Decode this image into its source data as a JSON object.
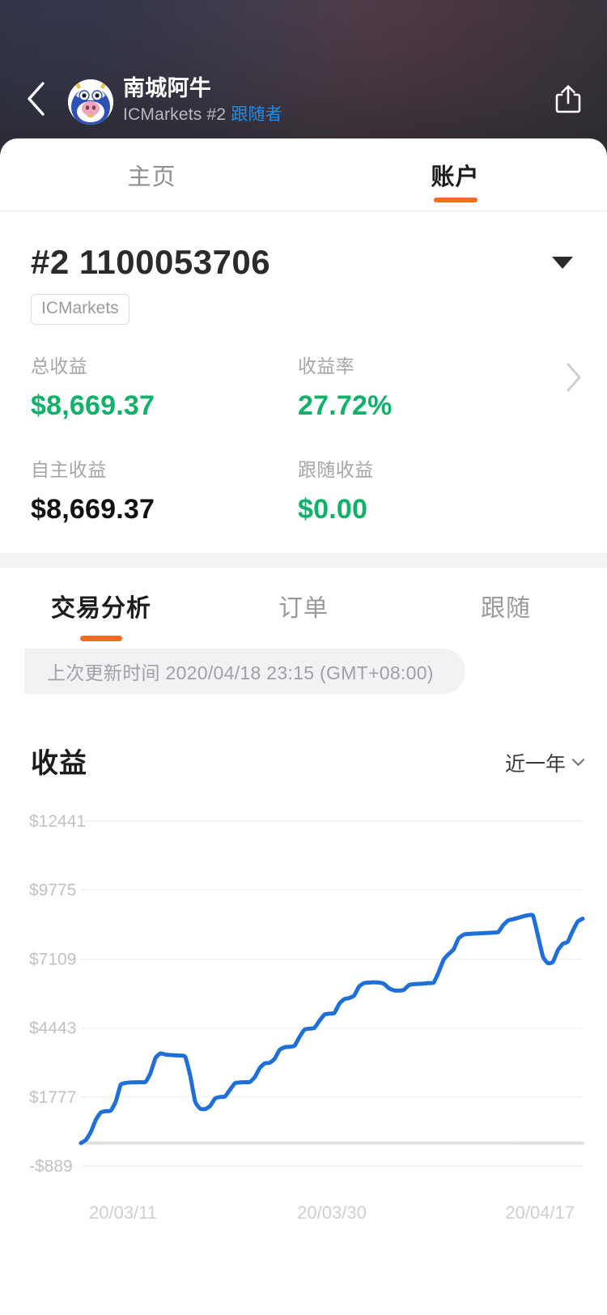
{
  "header": {
    "back_icon": "chevron-left-icon",
    "share_icon": "share-icon",
    "avatar_icon": "cow-avatar",
    "name": "南城阿牛",
    "broker": "ICMarkets",
    "account_tag": "#2",
    "follower_label": "跟随者",
    "subtitle_plain": "ICMarkets #2 "
  },
  "top_tabs": [
    {
      "label": "主页",
      "active": false
    },
    {
      "label": "账户",
      "active": true
    }
  ],
  "account": {
    "number": "#2 1100053706",
    "broker_chip": "ICMarkets",
    "dropdown_icon": "caret-down-icon",
    "detail_chevron_icon": "chevron-right-icon"
  },
  "stats": [
    {
      "label": "总收益",
      "value": "$8,669.37",
      "color": "green"
    },
    {
      "label": "收益率",
      "value": "27.72%",
      "color": "green"
    },
    {
      "label": "自主收益",
      "value": "$8,669.37",
      "color": "dark"
    },
    {
      "label": "跟随收益",
      "value": "$0.00",
      "color": "green"
    }
  ],
  "sub_tabs": [
    {
      "label": "交易分析",
      "active": true
    },
    {
      "label": "订单",
      "active": false
    },
    {
      "label": "跟随",
      "active": false
    }
  ],
  "update_banner": "上次更新时间 2020/04/18 23:15 (GMT+08:00)",
  "chart_header": {
    "title": "收益",
    "range_label": "近一年",
    "range_chevron_icon": "chevron-down-icon"
  },
  "colors": {
    "accent_orange": "#f26c21",
    "profit_green": "#0fb268",
    "line_blue": "#1e6fd9",
    "link_blue": "#1d8ced",
    "text_dark": "#1c1c1e",
    "text_muted": "#a0a0a5",
    "grid": "#f1f1f3",
    "baseline": "#e2e0de"
  },
  "chart_data": {
    "type": "line",
    "title": "收益",
    "xlabel": "",
    "ylabel": "",
    "grid": true,
    "legend": null,
    "ylim": [
      -889,
      12441
    ],
    "ytick_labels": [
      "$12441",
      "$9775",
      "$7109",
      "$4443",
      "$1777",
      "-$889"
    ],
    "yticks": [
      12441,
      9775,
      7109,
      4443,
      1777,
      -889
    ],
    "xtick_labels": [
      "20/03/11",
      "20/03/30",
      "20/04/17"
    ],
    "xticks": [
      "20/03/11",
      "20/03/30",
      "20/04/17"
    ],
    "baseline_value": 0,
    "series": [
      {
        "name": "收益",
        "color": "#1e6fd9",
        "values": [
          0,
          120,
          430,
          900,
          1180,
          1230,
          1250,
          1600,
          2250,
          2320,
          2340,
          2345,
          2350,
          2360,
          2700,
          3280,
          3460,
          3420,
          3400,
          3390,
          3380,
          3330,
          2600,
          1600,
          1330,
          1310,
          1430,
          1720,
          1780,
          1800,
          2060,
          2310,
          2340,
          2350,
          2360,
          2550,
          2900,
          3080,
          3100,
          3260,
          3600,
          3700,
          3720,
          3760,
          4100,
          4380,
          4420,
          4450,
          4720,
          4960,
          5000,
          5020,
          5380,
          5560,
          5600,
          5700,
          6050,
          6180,
          6200,
          6210,
          6200,
          6150,
          5980,
          5900,
          5890,
          5920,
          6100,
          6140,
          6150,
          6160,
          6180,
          6200,
          6600,
          7080,
          7300,
          7480,
          7900,
          8050,
          8080,
          8090,
          8100,
          8110,
          8120,
          8130,
          8150,
          8420,
          8600,
          8650,
          8700,
          8760,
          8800,
          8780,
          8000,
          7200,
          6950,
          7000,
          7450,
          7700,
          7780,
          8200,
          8560,
          8669
        ]
      }
    ]
  }
}
